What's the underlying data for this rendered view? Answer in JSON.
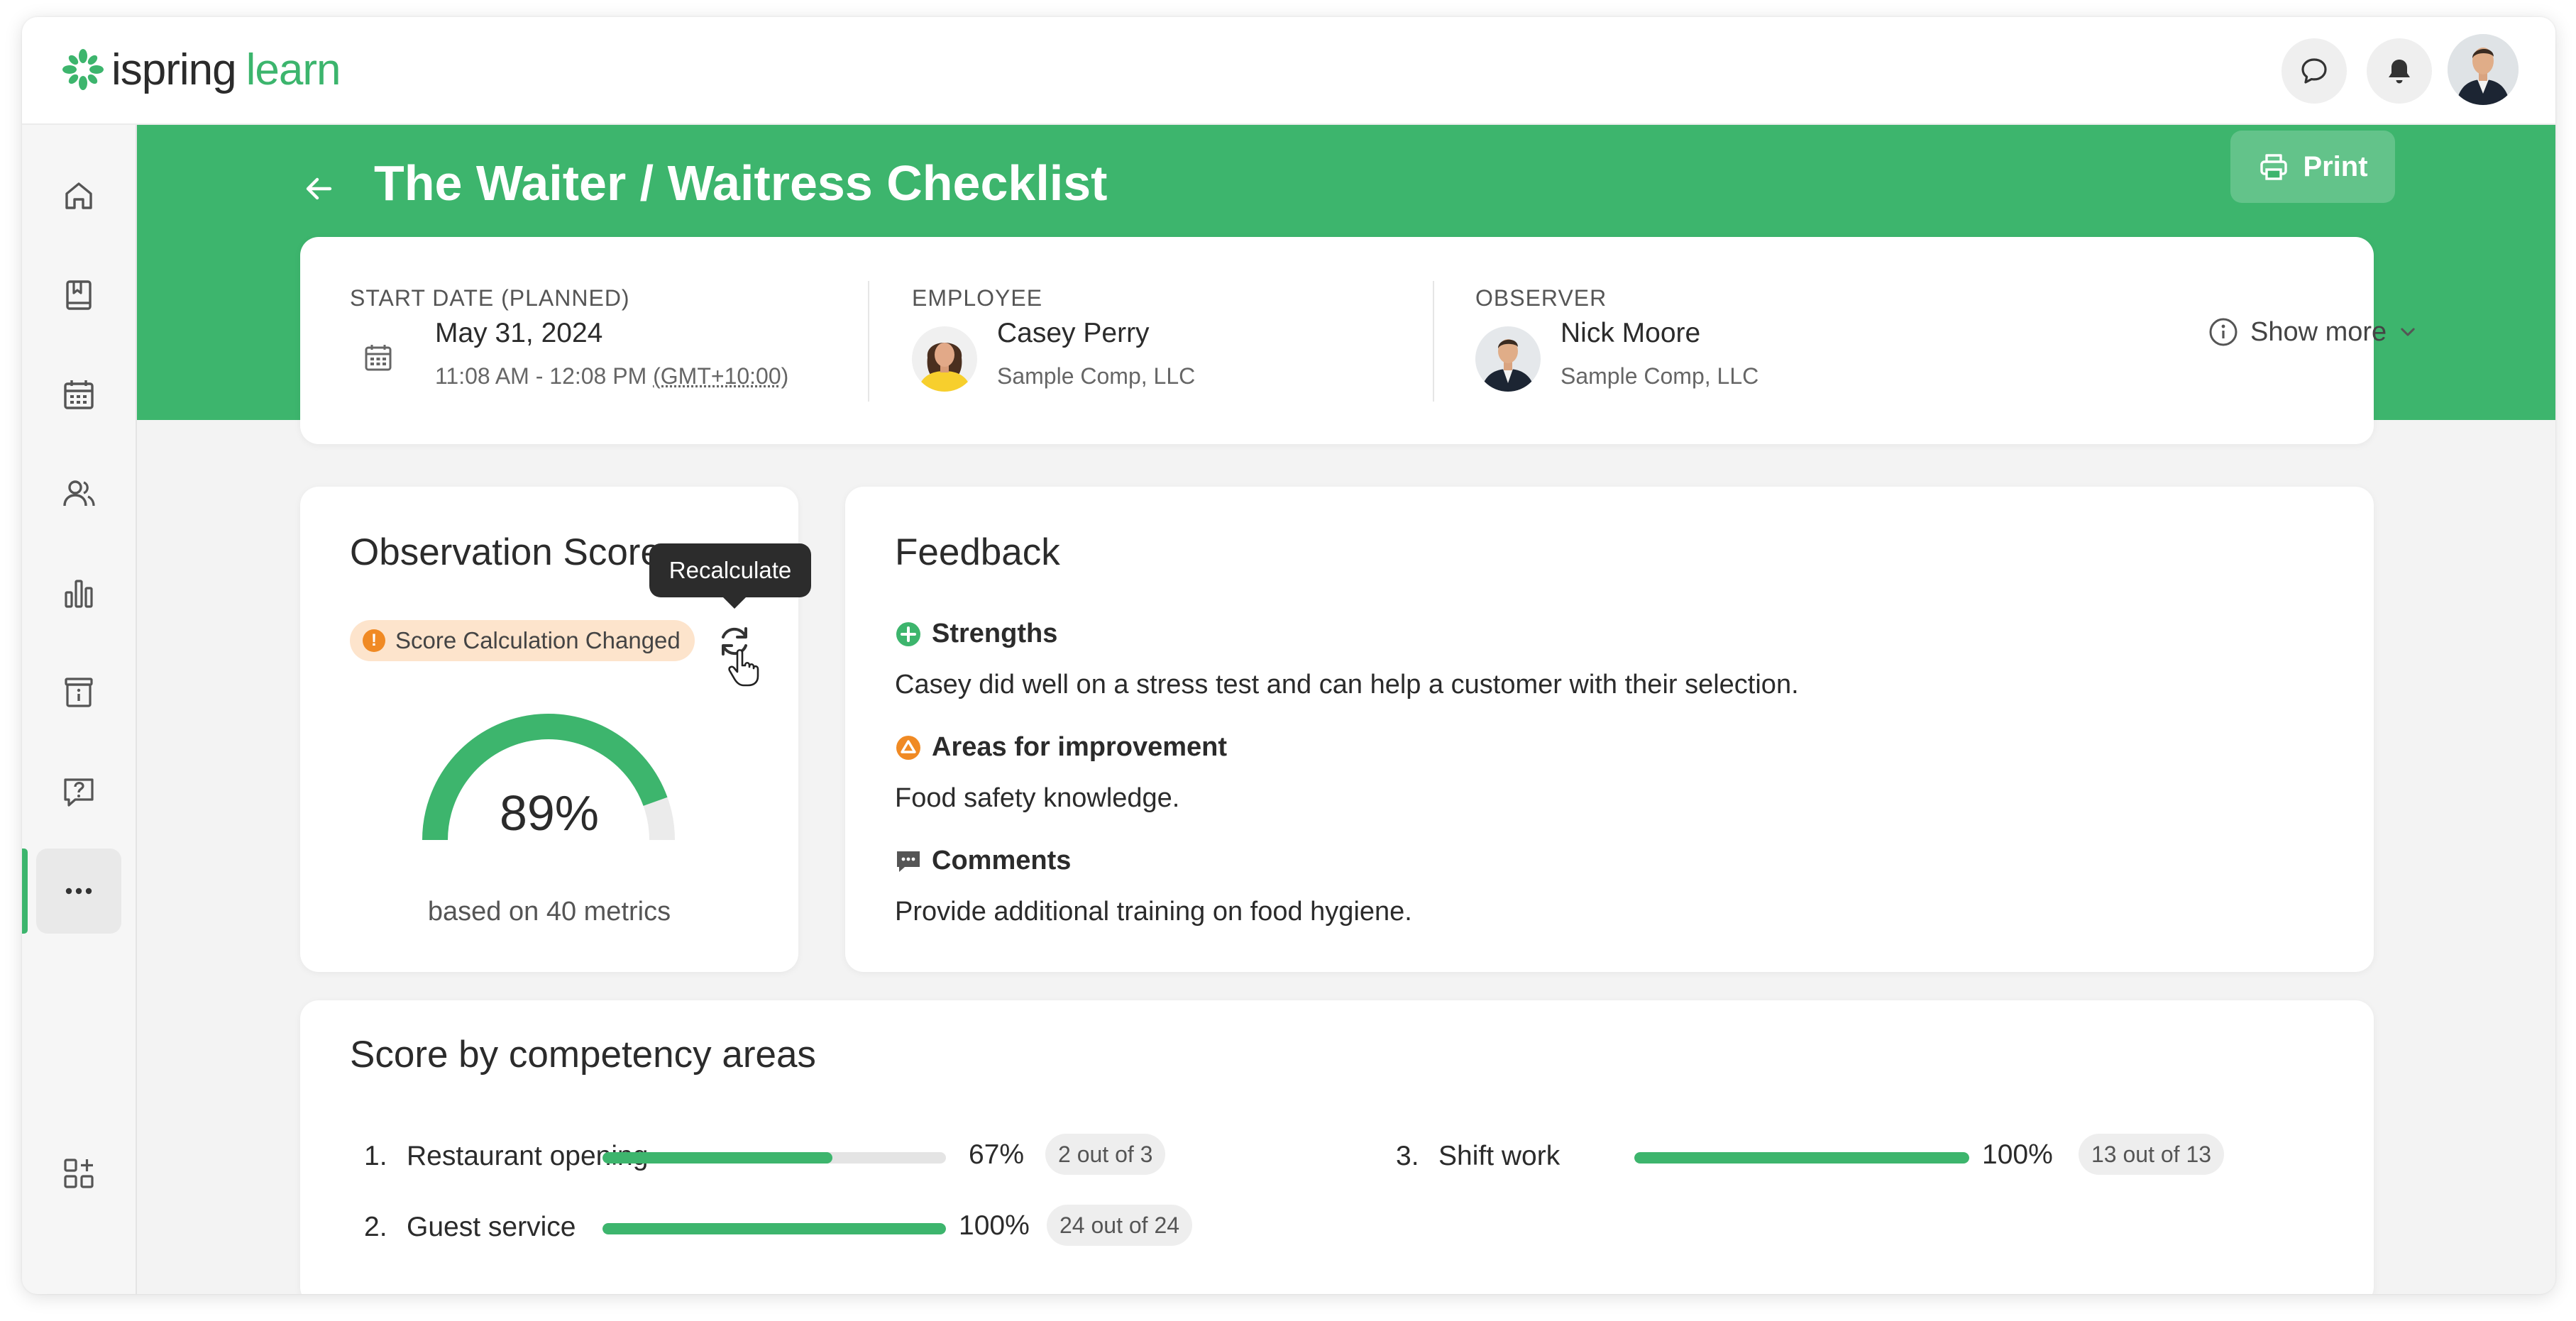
{
  "app": {
    "logo_word1": "ispring",
    "logo_word2": "learn",
    "accent_color": "#3db56d"
  },
  "topbar": {
    "icons": [
      "chat-bubble-icon",
      "bell-icon",
      "user-avatar"
    ]
  },
  "sidebar": {
    "items": [
      {
        "name": "home-icon"
      },
      {
        "name": "courses-icon"
      },
      {
        "name": "calendar-icon"
      },
      {
        "name": "users-icon"
      },
      {
        "name": "reports-icon"
      },
      {
        "name": "info-board-icon"
      },
      {
        "name": "help-chat-icon"
      },
      {
        "name": "more-icon",
        "active": true
      },
      {
        "name": "add-widget-icon"
      }
    ]
  },
  "page": {
    "title": "The Waiter / Waitress Checklist",
    "print_label": "Print"
  },
  "info": {
    "start_date_label": "START DATE (PLANNED)",
    "start_date": "May 31, 2024",
    "time_range": "11:08 AM - 12:08 PM",
    "timezone": "(GMT+10:00)",
    "employee_label": "EMPLOYEE",
    "employee_name": "Casey Perry",
    "employee_company": "Sample Comp, LLC",
    "observer_label": "OBSERVER",
    "observer_name": "Nick Moore",
    "observer_company": "Sample Comp, LLC",
    "show_more_label": "Show more"
  },
  "score": {
    "title": "Observation Score",
    "badge": "Score Calculation Changed",
    "tooltip": "Recalculate",
    "value_text": "89%",
    "value": 0.89,
    "metrics_text": "based on 40 metrics"
  },
  "feedback": {
    "title": "Feedback",
    "strengths_label": "Strengths",
    "strengths_text": "Casey did well on a stress test and can help a customer with their selection.",
    "improvement_label": "Areas for improvement",
    "improvement_text": "Food safety knowledge.",
    "comments_label": "Comments",
    "comments_text": "Provide additional training on food hygiene."
  },
  "competency": {
    "title": "Score by competency areas",
    "items": [
      {
        "num": "1.",
        "name": "Restaurant opening",
        "pct": "67%",
        "fraction": 0.67,
        "count": "2 out of 3"
      },
      {
        "num": "2.",
        "name": "Guest service",
        "pct": "100%",
        "fraction": 1.0,
        "count": "24 out of 24"
      },
      {
        "num": "3.",
        "name": "Shift work",
        "pct": "100%",
        "fraction": 1.0,
        "count": "13 out of 13"
      }
    ]
  }
}
